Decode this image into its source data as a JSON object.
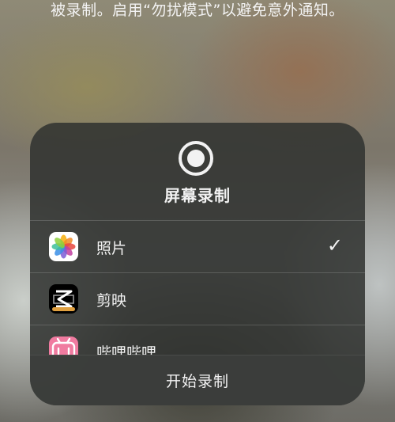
{
  "banner": {
    "text": "被录制。启用“勿扰模式”以避免意外通知。"
  },
  "sheet": {
    "title": "屏幕录制",
    "icon": "record-icon",
    "destinations": [
      {
        "label": "照片",
        "icon": "photos-app-icon",
        "selected": true,
        "check": "✓"
      },
      {
        "label": "剪映",
        "icon": "capcut-app-icon",
        "selected": false
      },
      {
        "label": "哔哩哔哩",
        "icon": "bilibili-app-icon",
        "selected": false
      }
    ],
    "start_button": "开始录制"
  },
  "colors": {
    "sheet_bg": "#303230",
    "text": "#f2f2f2",
    "bilibili_pink": "#f07ba0"
  }
}
